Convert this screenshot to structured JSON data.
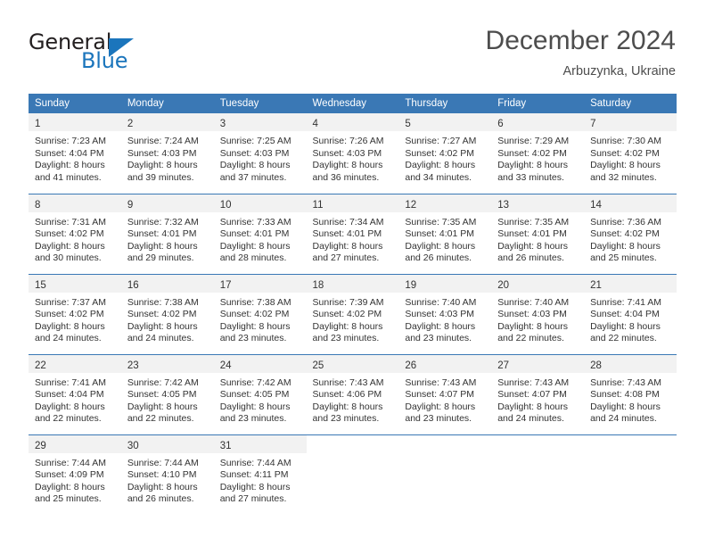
{
  "logo": {
    "word_one": "General",
    "word_two": "Blue",
    "triangle_color": "#1b75bc"
  },
  "header": {
    "month_title": "December 2024",
    "location": "Arbuzynka, Ukraine"
  },
  "theme": {
    "header_blue": "#3a78b5",
    "daynum_band": "#f2f2f2",
    "text": "#333333"
  },
  "calendar": {
    "weekday_headers": [
      "Sunday",
      "Monday",
      "Tuesday",
      "Wednesday",
      "Thursday",
      "Friday",
      "Saturday"
    ],
    "weeks": [
      [
        {
          "day": "1",
          "sunrise": "Sunrise: 7:23 AM",
          "sunset": "Sunset: 4:04 PM",
          "daylight_1": "Daylight: 8 hours",
          "daylight_2": "and 41 minutes."
        },
        {
          "day": "2",
          "sunrise": "Sunrise: 7:24 AM",
          "sunset": "Sunset: 4:03 PM",
          "daylight_1": "Daylight: 8 hours",
          "daylight_2": "and 39 minutes."
        },
        {
          "day": "3",
          "sunrise": "Sunrise: 7:25 AM",
          "sunset": "Sunset: 4:03 PM",
          "daylight_1": "Daylight: 8 hours",
          "daylight_2": "and 37 minutes."
        },
        {
          "day": "4",
          "sunrise": "Sunrise: 7:26 AM",
          "sunset": "Sunset: 4:03 PM",
          "daylight_1": "Daylight: 8 hours",
          "daylight_2": "and 36 minutes."
        },
        {
          "day": "5",
          "sunrise": "Sunrise: 7:27 AM",
          "sunset": "Sunset: 4:02 PM",
          "daylight_1": "Daylight: 8 hours",
          "daylight_2": "and 34 minutes."
        },
        {
          "day": "6",
          "sunrise": "Sunrise: 7:29 AM",
          "sunset": "Sunset: 4:02 PM",
          "daylight_1": "Daylight: 8 hours",
          "daylight_2": "and 33 minutes."
        },
        {
          "day": "7",
          "sunrise": "Sunrise: 7:30 AM",
          "sunset": "Sunset: 4:02 PM",
          "daylight_1": "Daylight: 8 hours",
          "daylight_2": "and 32 minutes."
        }
      ],
      [
        {
          "day": "8",
          "sunrise": "Sunrise: 7:31 AM",
          "sunset": "Sunset: 4:02 PM",
          "daylight_1": "Daylight: 8 hours",
          "daylight_2": "and 30 minutes."
        },
        {
          "day": "9",
          "sunrise": "Sunrise: 7:32 AM",
          "sunset": "Sunset: 4:01 PM",
          "daylight_1": "Daylight: 8 hours",
          "daylight_2": "and 29 minutes."
        },
        {
          "day": "10",
          "sunrise": "Sunrise: 7:33 AM",
          "sunset": "Sunset: 4:01 PM",
          "daylight_1": "Daylight: 8 hours",
          "daylight_2": "and 28 minutes."
        },
        {
          "day": "11",
          "sunrise": "Sunrise: 7:34 AM",
          "sunset": "Sunset: 4:01 PM",
          "daylight_1": "Daylight: 8 hours",
          "daylight_2": "and 27 minutes."
        },
        {
          "day": "12",
          "sunrise": "Sunrise: 7:35 AM",
          "sunset": "Sunset: 4:01 PM",
          "daylight_1": "Daylight: 8 hours",
          "daylight_2": "and 26 minutes."
        },
        {
          "day": "13",
          "sunrise": "Sunrise: 7:35 AM",
          "sunset": "Sunset: 4:01 PM",
          "daylight_1": "Daylight: 8 hours",
          "daylight_2": "and 26 minutes."
        },
        {
          "day": "14",
          "sunrise": "Sunrise: 7:36 AM",
          "sunset": "Sunset: 4:02 PM",
          "daylight_1": "Daylight: 8 hours",
          "daylight_2": "and 25 minutes."
        }
      ],
      [
        {
          "day": "15",
          "sunrise": "Sunrise: 7:37 AM",
          "sunset": "Sunset: 4:02 PM",
          "daylight_1": "Daylight: 8 hours",
          "daylight_2": "and 24 minutes."
        },
        {
          "day": "16",
          "sunrise": "Sunrise: 7:38 AM",
          "sunset": "Sunset: 4:02 PM",
          "daylight_1": "Daylight: 8 hours",
          "daylight_2": "and 24 minutes."
        },
        {
          "day": "17",
          "sunrise": "Sunrise: 7:38 AM",
          "sunset": "Sunset: 4:02 PM",
          "daylight_1": "Daylight: 8 hours",
          "daylight_2": "and 23 minutes."
        },
        {
          "day": "18",
          "sunrise": "Sunrise: 7:39 AM",
          "sunset": "Sunset: 4:02 PM",
          "daylight_1": "Daylight: 8 hours",
          "daylight_2": "and 23 minutes."
        },
        {
          "day": "19",
          "sunrise": "Sunrise: 7:40 AM",
          "sunset": "Sunset: 4:03 PM",
          "daylight_1": "Daylight: 8 hours",
          "daylight_2": "and 23 minutes."
        },
        {
          "day": "20",
          "sunrise": "Sunrise: 7:40 AM",
          "sunset": "Sunset: 4:03 PM",
          "daylight_1": "Daylight: 8 hours",
          "daylight_2": "and 22 minutes."
        },
        {
          "day": "21",
          "sunrise": "Sunrise: 7:41 AM",
          "sunset": "Sunset: 4:04 PM",
          "daylight_1": "Daylight: 8 hours",
          "daylight_2": "and 22 minutes."
        }
      ],
      [
        {
          "day": "22",
          "sunrise": "Sunrise: 7:41 AM",
          "sunset": "Sunset: 4:04 PM",
          "daylight_1": "Daylight: 8 hours",
          "daylight_2": "and 22 minutes."
        },
        {
          "day": "23",
          "sunrise": "Sunrise: 7:42 AM",
          "sunset": "Sunset: 4:05 PM",
          "daylight_1": "Daylight: 8 hours",
          "daylight_2": "and 22 minutes."
        },
        {
          "day": "24",
          "sunrise": "Sunrise: 7:42 AM",
          "sunset": "Sunset: 4:05 PM",
          "daylight_1": "Daylight: 8 hours",
          "daylight_2": "and 23 minutes."
        },
        {
          "day": "25",
          "sunrise": "Sunrise: 7:43 AM",
          "sunset": "Sunset: 4:06 PM",
          "daylight_1": "Daylight: 8 hours",
          "daylight_2": "and 23 minutes."
        },
        {
          "day": "26",
          "sunrise": "Sunrise: 7:43 AM",
          "sunset": "Sunset: 4:07 PM",
          "daylight_1": "Daylight: 8 hours",
          "daylight_2": "and 23 minutes."
        },
        {
          "day": "27",
          "sunrise": "Sunrise: 7:43 AM",
          "sunset": "Sunset: 4:07 PM",
          "daylight_1": "Daylight: 8 hours",
          "daylight_2": "and 24 minutes."
        },
        {
          "day": "28",
          "sunrise": "Sunrise: 7:43 AM",
          "sunset": "Sunset: 4:08 PM",
          "daylight_1": "Daylight: 8 hours",
          "daylight_2": "and 24 minutes."
        }
      ],
      [
        {
          "day": "29",
          "sunrise": "Sunrise: 7:44 AM",
          "sunset": "Sunset: 4:09 PM",
          "daylight_1": "Daylight: 8 hours",
          "daylight_2": "and 25 minutes."
        },
        {
          "day": "30",
          "sunrise": "Sunrise: 7:44 AM",
          "sunset": "Sunset: 4:10 PM",
          "daylight_1": "Daylight: 8 hours",
          "daylight_2": "and 26 minutes."
        },
        {
          "day": "31",
          "sunrise": "Sunrise: 7:44 AM",
          "sunset": "Sunset: 4:11 PM",
          "daylight_1": "Daylight: 8 hours",
          "daylight_2": "and 27 minutes."
        },
        null,
        null,
        null,
        null
      ]
    ]
  }
}
